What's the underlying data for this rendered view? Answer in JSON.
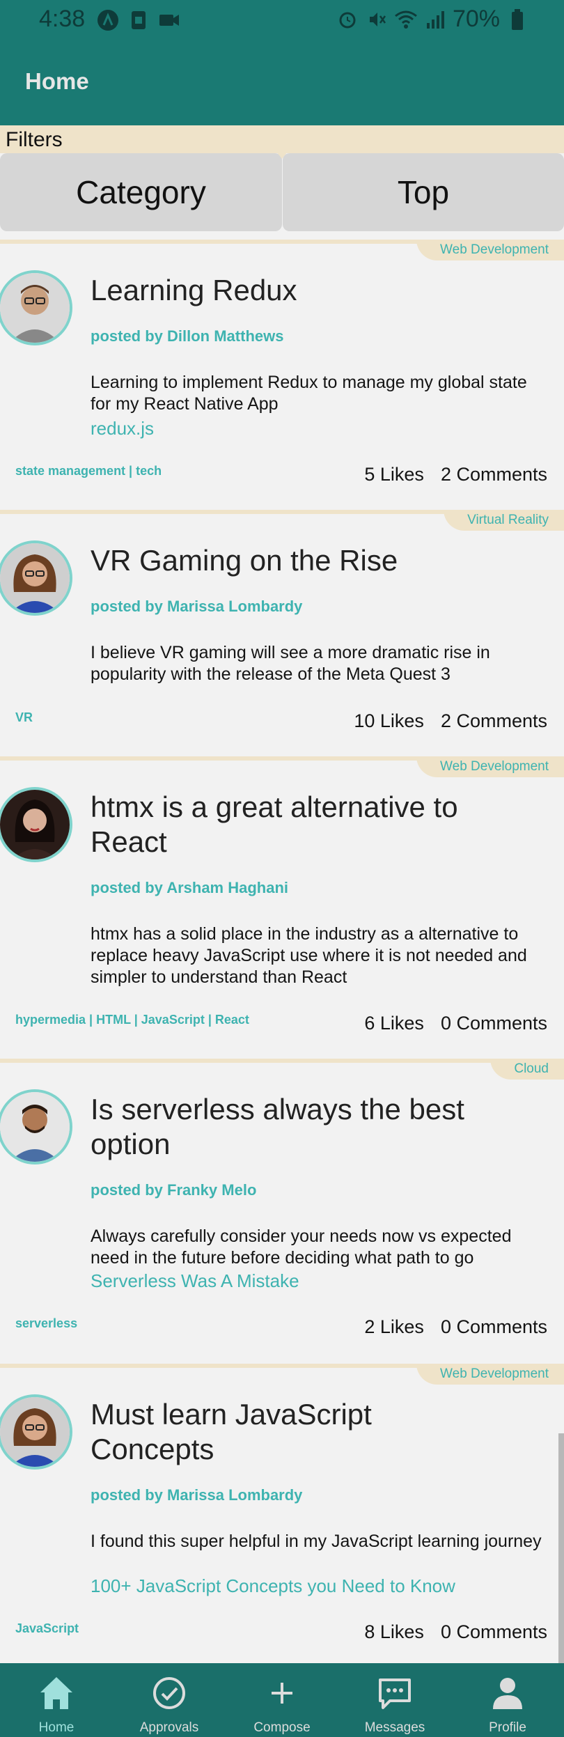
{
  "status": {
    "time": "4:38",
    "battery": "70%"
  },
  "app": {
    "title": "Home"
  },
  "filters": {
    "label": "Filters",
    "category_button": "Category",
    "top_button": "Top"
  },
  "posts": [
    {
      "category": "Web Development",
      "title": "Learning Redux",
      "author": "posted by Dillon Matthews",
      "body": "Learning to implement Redux to manage my global state for my React Native App",
      "link": "redux.js",
      "tags": "state management | tech",
      "likes": "5 Likes",
      "comments": "2 Comments"
    },
    {
      "category": "Virtual Reality",
      "title": "VR Gaming on the Rise",
      "author": "posted by Marissa Lombardy",
      "body": "I believe VR gaming will see a more dramatic rise in popularity with the release of the Meta Quest 3",
      "link": "",
      "tags": "VR",
      "likes": "10 Likes",
      "comments": "2 Comments"
    },
    {
      "category": "Web Development",
      "title": "htmx is a great alternative to React",
      "author": "posted by Arsham Haghani",
      "body": "htmx has a solid place in the industry as a alternative to replace heavy JavaScript use where it is not needed and simpler to understand than React",
      "link": "",
      "tags": "hypermedia | HTML | JavaScript | React",
      "likes": "6 Likes",
      "comments": "0 Comments"
    },
    {
      "category": "Cloud",
      "title": "Is serverless always the best option",
      "author": "posted by Franky Melo",
      "body": "Always carefully consider your needs now vs expected need in the future before deciding what path to go",
      "link": "Serverless Was A Mistake",
      "tags": "serverless",
      "likes": "2 Likes",
      "comments": "0 Comments"
    },
    {
      "category": "Web Development",
      "title": "Must learn JavaScript Concepts",
      "author": "posted by Marissa Lombardy",
      "body": "I found this super helpful in my JavaScript learning journey",
      "link": "100+ JavaScript Concepts you Need to Know",
      "tags": "JavaScript",
      "likes": "8 Likes",
      "comments": "0 Comments"
    }
  ],
  "nav": {
    "home": "Home",
    "approvals": "Approvals",
    "compose": "Compose",
    "messages": "Messages",
    "profile": "Profile"
  },
  "colors": {
    "header": "#1a7a73",
    "accent": "#3eb3b0",
    "filters_bg": "#efe3c9",
    "nav_bg": "#1a6f6a"
  },
  "icons": {
    "status_left": [
      "app-icon",
      "sim-icon",
      "video-icon"
    ],
    "status_right": [
      "alarm-icon",
      "mute-icon",
      "wifi-icon",
      "signal-icon",
      "battery-icon"
    ],
    "nav": [
      "home-icon",
      "check-circle-icon",
      "plus-icon",
      "chat-icon",
      "person-icon"
    ]
  }
}
